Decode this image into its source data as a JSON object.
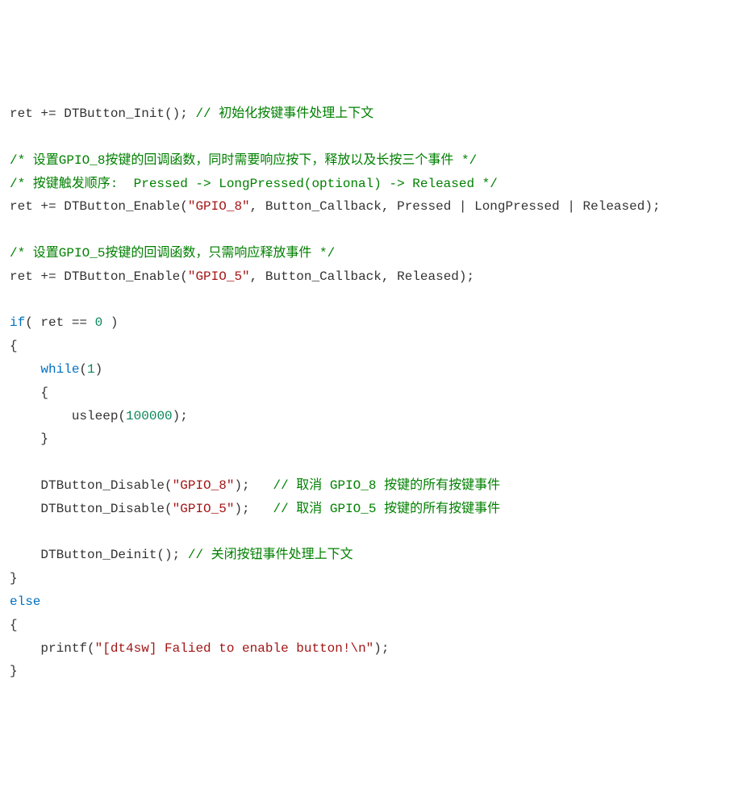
{
  "lines": [
    [
      {
        "text": "ret += DTButton_Init(); ",
        "cls": ""
      },
      {
        "text": "// 初始化按键事件处理上下文",
        "cls": "cmt"
      }
    ],
    [],
    [
      {
        "text": "/* 设置GPIO_8按键的回调函数，同时需要响应按下，释放以及长按三个事件 */",
        "cls": "cmtb"
      }
    ],
    [
      {
        "text": "/* 按键触发顺序:  Pressed -> LongPressed(optional) -> Released */",
        "cls": "cmtb"
      }
    ],
    [
      {
        "text": "ret += DTButton_Enable(",
        "cls": ""
      },
      {
        "text": "\"GPIO_8\"",
        "cls": "str"
      },
      {
        "text": ", Button_Callback, Pressed | LongPressed | Released);",
        "cls": ""
      }
    ],
    [],
    [
      {
        "text": "/* 设置GPIO_5按键的回调函数，只需响应释放事件 */",
        "cls": "cmtb"
      }
    ],
    [
      {
        "text": "ret += DTButton_Enable(",
        "cls": ""
      },
      {
        "text": "\"GPIO_5\"",
        "cls": "str"
      },
      {
        "text": ", Button_Callback, Released);",
        "cls": ""
      }
    ],
    [],
    [
      {
        "text": "if",
        "cls": "kw"
      },
      {
        "text": "( ret == ",
        "cls": ""
      },
      {
        "text": "0",
        "cls": "num"
      },
      {
        "text": " )",
        "cls": ""
      }
    ],
    [
      {
        "text": "{",
        "cls": ""
      }
    ],
    [
      {
        "text": "    ",
        "cls": ""
      },
      {
        "text": "while",
        "cls": "kw"
      },
      {
        "text": "(",
        "cls": ""
      },
      {
        "text": "1",
        "cls": "num"
      },
      {
        "text": ")",
        "cls": ""
      }
    ],
    [
      {
        "text": "    {",
        "cls": ""
      }
    ],
    [
      {
        "text": "        usleep(",
        "cls": ""
      },
      {
        "text": "100000",
        "cls": "num"
      },
      {
        "text": ");",
        "cls": ""
      }
    ],
    [
      {
        "text": "    }",
        "cls": ""
      }
    ],
    [],
    [
      {
        "text": "    DTButton_Disable(",
        "cls": ""
      },
      {
        "text": "\"GPIO_8\"",
        "cls": "str"
      },
      {
        "text": ");   ",
        "cls": ""
      },
      {
        "text": "// 取消 GPIO_8 按键的所有按键事件",
        "cls": "cmt"
      }
    ],
    [
      {
        "text": "    DTButton_Disable(",
        "cls": ""
      },
      {
        "text": "\"GPIO_5\"",
        "cls": "str"
      },
      {
        "text": ");   ",
        "cls": ""
      },
      {
        "text": "// 取消 GPIO_5 按键的所有按键事件",
        "cls": "cmt"
      }
    ],
    [],
    [
      {
        "text": "    DTButton_Deinit(); ",
        "cls": ""
      },
      {
        "text": "// 关闭按钮事件处理上下文",
        "cls": "cmt"
      }
    ],
    [
      {
        "text": "}",
        "cls": ""
      }
    ],
    [
      {
        "text": "else",
        "cls": "kw"
      }
    ],
    [
      {
        "text": "{",
        "cls": ""
      }
    ],
    [
      {
        "text": "    printf(",
        "cls": ""
      },
      {
        "text": "\"[dt4sw] Falied to enable button!\\n\"",
        "cls": "str"
      },
      {
        "text": ");",
        "cls": ""
      }
    ],
    [
      {
        "text": "}",
        "cls": ""
      }
    ]
  ]
}
